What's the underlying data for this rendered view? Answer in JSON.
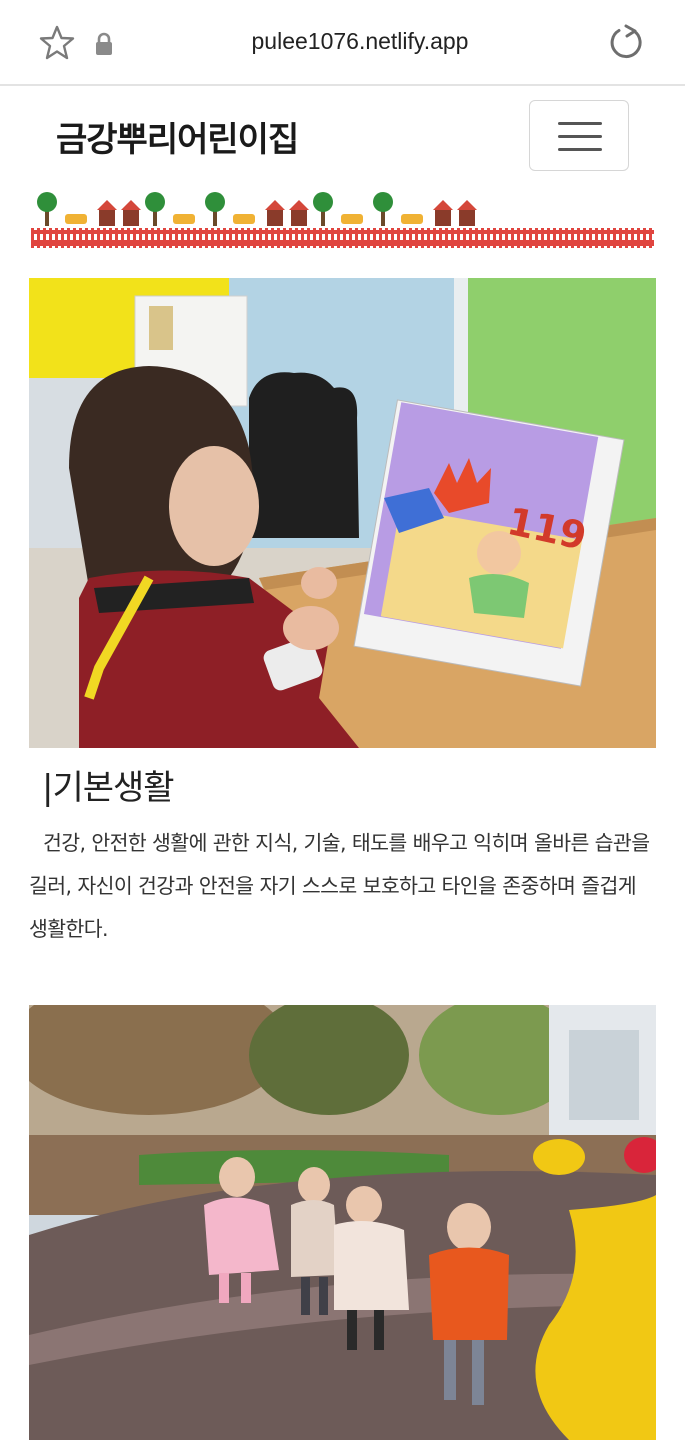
{
  "browser": {
    "url": "pulee1076.netlify.app",
    "icons": [
      "star-icon",
      "lock-icon",
      "reload-icon"
    ]
  },
  "header": {
    "title": "금강뿌리어린이집",
    "menu_icon": "hamburger-icon"
  },
  "sections": [
    {
      "heading": "|기본생활",
      "body": "건강, 안전한 생활에 관한 지식, 기술, 태도를 배우고 익히며 올바른 습관을 길러, 자신이 건강과 안전을 자기 스스로 보호하고 타인을 존중하며 즐겁게 생활한다."
    }
  ],
  "illustrations": {
    "book_page_number": "119"
  },
  "colors": {
    "fence_red": "#e0453f",
    "tree_green": "#2f8f3a"
  }
}
